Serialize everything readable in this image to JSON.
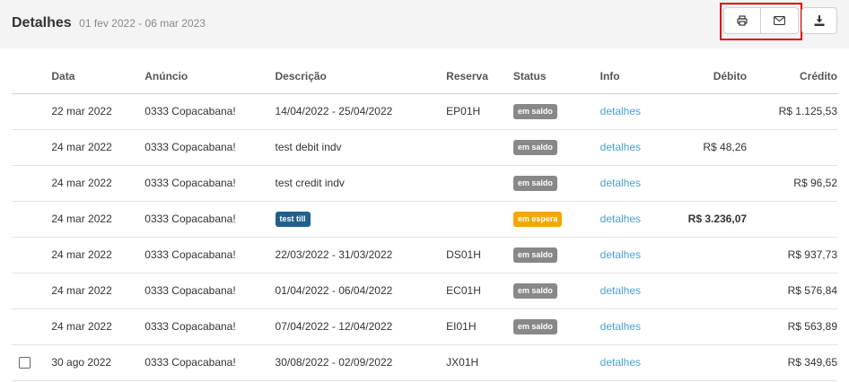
{
  "header": {
    "title": "Detalhes",
    "date_range": "01 fev 2022 - 06 mar 2023"
  },
  "toolbar": {
    "icons": [
      "print-icon",
      "mail-icon",
      "download-icon"
    ]
  },
  "table": {
    "columns": {
      "date": "Data",
      "listing": "Anúncio",
      "description": "Descrição",
      "reservation": "Reserva",
      "status": "Status",
      "info": "Info",
      "debit": "Débito",
      "credit": "Crédito"
    },
    "rows": [
      {
        "date": "22 mar 2022",
        "listing": "0333 Copacabana!",
        "description": "14/04/2022 - 25/04/2022",
        "reservation": "EP01H",
        "status": "em saldo",
        "info": "detalhes",
        "debit": "",
        "credit": "R$ 1.125,53"
      },
      {
        "date": "24 mar 2022",
        "listing": "0333 Copacabana!",
        "description": "test debit indv",
        "reservation": "",
        "status": "em saldo",
        "info": "detalhes",
        "debit": "R$ 48,26",
        "credit": ""
      },
      {
        "date": "24 mar 2022",
        "listing": "0333 Copacabana!",
        "description": "test credit indv",
        "reservation": "",
        "status": "em saldo",
        "info": "detalhes",
        "debit": "",
        "credit": "R$ 96,52"
      },
      {
        "date": "24 mar 2022",
        "listing": "0333 Copacabana!",
        "description_badge": "test till",
        "reservation": "",
        "status": "em espera",
        "info": "detalhes",
        "debit": "R$ 3.236,07",
        "credit": ""
      },
      {
        "date": "24 mar 2022",
        "listing": "0333 Copacabana!",
        "description": "22/03/2022 - 31/03/2022",
        "reservation": "DS01H",
        "status": "em saldo",
        "info": "detalhes",
        "debit": "",
        "credit": "R$ 937,73"
      },
      {
        "date": "24 mar 2022",
        "listing": "0333 Copacabana!",
        "description": "01/04/2022 - 06/04/2022",
        "reservation": "EC01H",
        "status": "em saldo",
        "info": "detalhes",
        "debit": "",
        "credit": "R$ 576,84"
      },
      {
        "date": "24 mar 2022",
        "listing": "0333 Copacabana!",
        "description": "07/04/2022 - 12/04/2022",
        "reservation": "EI01H",
        "status": "em saldo",
        "info": "detalhes",
        "debit": "",
        "credit": "R$ 563,89"
      },
      {
        "date": "30 ago 2022",
        "listing": "0333 Copacabana!",
        "description": "30/08/2022 - 02/09/2022",
        "reservation": "JX01H",
        "status": "",
        "info": "detalhes",
        "debit": "",
        "credit": "R$ 349,65"
      }
    ]
  },
  "colors": {
    "header_bg": "#f4f4f4",
    "badge_gray": "#888888",
    "badge_orange": "#f5a700",
    "badge_blue": "#1f5f8b",
    "link": "#4a9fd6",
    "highlight": "#e00000"
  }
}
